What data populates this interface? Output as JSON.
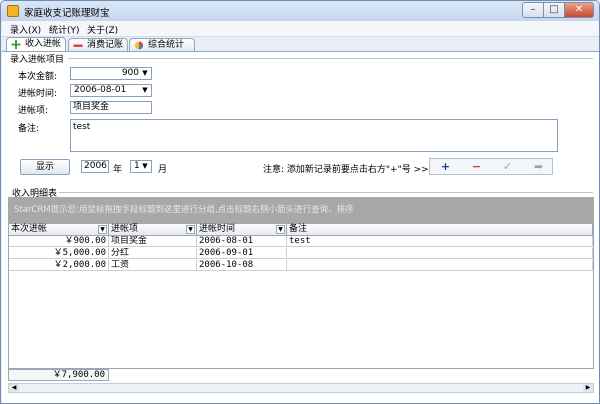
{
  "window": {
    "title": "家庭收支记账理财宝"
  },
  "menu": [
    "录入(X)",
    "统计(Y)",
    "关于(Z)"
  ],
  "tabs": [
    "收入进帐",
    "消费记账",
    "综合统计"
  ],
  "entry": {
    "section_title": "录入进帐项目",
    "amount_label": "本次金额:",
    "amount_value": "900",
    "date_label": "进帐时间:",
    "date_value": "2006-08-01",
    "item_label": "进帐项:",
    "item_value": "项目奖金",
    "note_label": "备注:",
    "note_value": "test"
  },
  "filter": {
    "show_button": "显示",
    "year_value": "2006",
    "year_unit": "年",
    "month_value": "1",
    "month_unit": "月",
    "hint": "注意: 添加新记录前要点击右方\"+\"号 >>"
  },
  "nav_buttons": {
    "add": "+",
    "remove": "−",
    "confirm": "✓",
    "refresh": "➦"
  },
  "list": {
    "section_title": "收入明细表",
    "group_hint": "StarCRM提示您:用鼠标拖拽字段标题到这里进行分组,点击标题右侧小箭头进行查询、排序",
    "columns": [
      "本次进帐",
      "进帐项",
      "进帐时间",
      "备注"
    ],
    "rows": [
      [
        "￥900.00",
        "项目奖金",
        "2006-08-01",
        "test"
      ],
      [
        "￥5,000.00",
        "分红",
        "2006-09-01",
        ""
      ],
      [
        "￥2,000.00",
        "工资",
        "2006-10-08",
        ""
      ]
    ],
    "total": "￥7,900.00"
  },
  "colors": {
    "accent": "#2a56a8",
    "title_bar": "#c4d6ee",
    "group_area": "#a8a8a8"
  }
}
